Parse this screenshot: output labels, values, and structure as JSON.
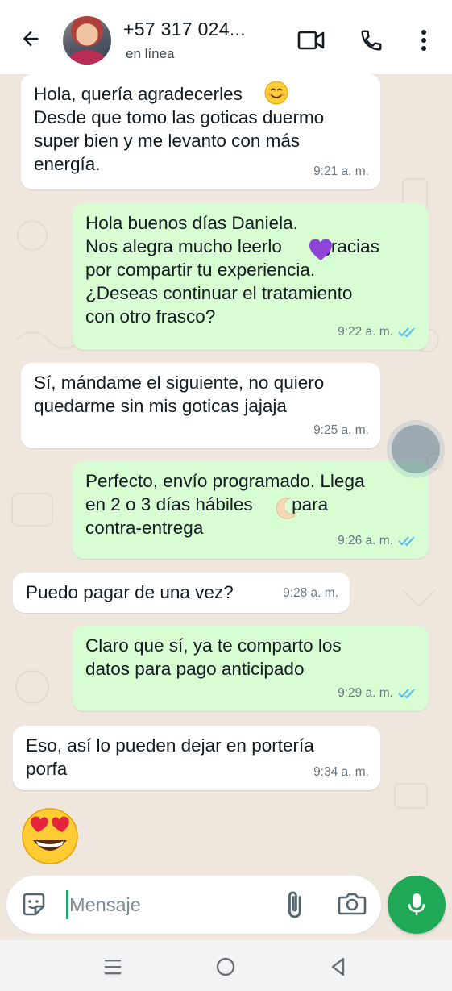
{
  "header": {
    "contact_name": "+57 317 024...",
    "status": "en línea",
    "icons": [
      "back-arrow-icon",
      "video-call-icon",
      "phone-icon",
      "more-vertical-icon"
    ]
  },
  "messages": [
    {
      "direction": "in",
      "text": "Hola, quería agradecerles \nDesde que tomo las goticas duermo\nsuper bien y me levanto con más\nenergía.",
      "time": "9:21 a. m."
    },
    {
      "direction": "out",
      "text_a": "Hola buenos días Daniela.\nNos alegra mucho leerlo ",
      "text_b": " gracias\npor compartir tu experiencia.\n¿Deseas continuar el tratamiento\ncon otro frasco?",
      "time": "9:22 a. m."
    },
    {
      "direction": "in",
      "text": "Sí, mándame el siguiente, no quiero\nquedarme sin mis goticas jajaja",
      "time": "9:25 a. m."
    },
    {
      "direction": "out",
      "text_a": "Perfecto, envío programado. Llega\nen 2 o 3 días hábiles ",
      "text_b": " para\ncontra-entrega",
      "time": "9:26 a. m."
    },
    {
      "direction": "in",
      "text": "Puedo pagar de una vez?",
      "time": "9:28 a. m."
    },
    {
      "direction": "out",
      "text": "Claro que sí, ya te comparto los\ndatos para pago anticipado",
      "time": "9:29 a. m."
    },
    {
      "direction": "in",
      "text": "Eso, así lo pueden dejar en portería\nporfa",
      "time": "9:34 a. m."
    }
  ],
  "emojis": [
    "smiling-face-emoji",
    "purple-heart-emoji",
    "crescent-moon-emoji",
    "heart-eyes-emoji"
  ],
  "input": {
    "placeholder": "Mensaje"
  },
  "colors": {
    "incoming": "#ffffff",
    "outgoing": "#d9fdd3",
    "accent": "#1fa855",
    "read_ticks": "#53bdeb"
  }
}
